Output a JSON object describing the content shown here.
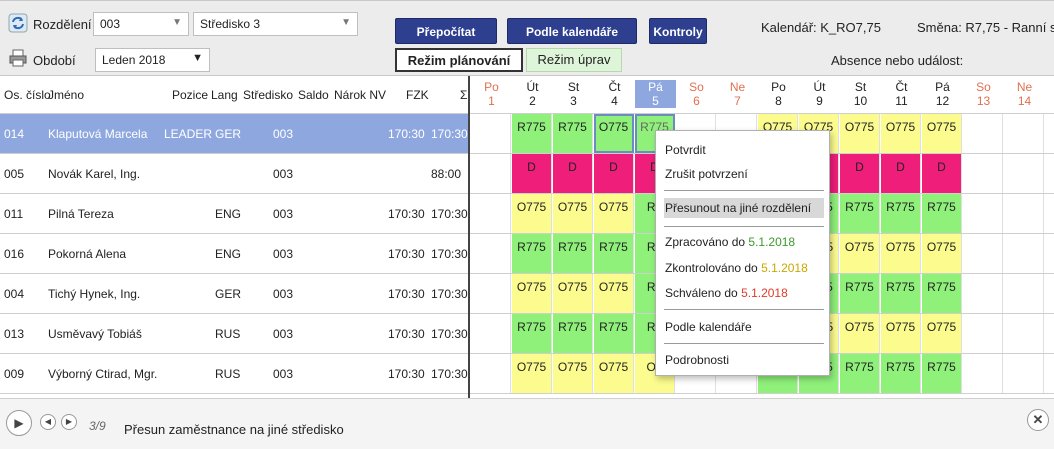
{
  "toolbar": {
    "rozdeleni_label": "Rozdělení",
    "obdobi_label": "Období",
    "rozdeleni_value": "003",
    "stredisko_value": "Středisko 3",
    "obdobi_value": "Leden 2018",
    "btn_prepocitat": "Přepočítat",
    "btn_podle_kalendare": "Podle kalendáře",
    "btn_kontroly": "Kontroly",
    "mode_planovani": "Režim plánování",
    "mode_uprav": "Režim úprav",
    "kalendar": "Kalendář: K_RO7,75",
    "smena": "Směna: R7,75 - Ranní s",
    "absence": "Absence nebo událost:"
  },
  "columns": {
    "os_cislo": "Os. číslo",
    "jmeno": "Jméno",
    "pozice": "Pozice",
    "lang": "Lang",
    "stredisko": "Středisko",
    "saldo": "Saldo",
    "narok_nv": "Nárok NV",
    "fzk": "FZK",
    "sigma": "Σ"
  },
  "days": [
    {
      "name": "Po",
      "num": "1",
      "weekend": true
    },
    {
      "name": "Út",
      "num": "2",
      "weekend": false
    },
    {
      "name": "St",
      "num": "3",
      "weekend": false
    },
    {
      "name": "Čt",
      "num": "4",
      "weekend": false
    },
    {
      "name": "Pá",
      "num": "5",
      "weekend": false,
      "selected": true
    },
    {
      "name": "So",
      "num": "6",
      "weekend": true
    },
    {
      "name": "Ne",
      "num": "7",
      "weekend": true
    },
    {
      "name": "Po",
      "num": "8",
      "weekend": false
    },
    {
      "name": "Út",
      "num": "9",
      "weekend": false
    },
    {
      "name": "St",
      "num": "10",
      "weekend": false
    },
    {
      "name": "Čt",
      "num": "11",
      "weekend": false
    },
    {
      "name": "Pá",
      "num": "12",
      "weekend": false
    },
    {
      "name": "So",
      "num": "13",
      "weekend": true
    },
    {
      "name": "Ne",
      "num": "14",
      "weekend": true
    }
  ],
  "employees": [
    {
      "os": "014",
      "jmeno": "Klaputová Marcela",
      "pozice": "LEADER",
      "lang": "GER",
      "stredisko": "003",
      "fzk": "170:30",
      "sigma": "170:30",
      "selected": true,
      "shifts": [
        "",
        "R775",
        "R775",
        "O775",
        "R775",
        "",
        "",
        "O775",
        "O775",
        "O775",
        "O775",
        "O775",
        "",
        ""
      ],
      "colors": [
        "e",
        "g",
        "g",
        "g",
        "g",
        "e",
        "e",
        "y",
        "y",
        "y",
        "y",
        "y",
        "e",
        "e"
      ]
    },
    {
      "os": "005",
      "jmeno": "Novák Karel, Ing.",
      "pozice": "",
      "lang": "",
      "stredisko": "003",
      "fzk": "",
      "sigma": "88:00",
      "shifts": [
        "",
        "D",
        "D",
        "D",
        "D",
        "",
        "",
        "D",
        "D",
        "D",
        "D",
        "D",
        "",
        ""
      ],
      "colors": [
        "e",
        "p",
        "p",
        "p",
        "p",
        "e",
        "e",
        "p",
        "p",
        "p",
        "p",
        "p",
        "e",
        "e"
      ]
    },
    {
      "os": "011",
      "jmeno": "Pilná Tereza",
      "pozice": "",
      "lang": "ENG",
      "stredisko": "003",
      "fzk": "170:30",
      "sigma": "170:30",
      "shifts": [
        "",
        "O775",
        "O775",
        "O775",
        "R7",
        "",
        "",
        "R775",
        "R775",
        "R775",
        "R775",
        "R775",
        "",
        ""
      ],
      "colors": [
        "e",
        "y",
        "y",
        "y",
        "g",
        "e",
        "e",
        "g",
        "g",
        "g",
        "g",
        "g",
        "e",
        "e"
      ]
    },
    {
      "os": "016",
      "jmeno": "Pokorná Alena",
      "pozice": "",
      "lang": "ENG",
      "stredisko": "003",
      "fzk": "170:30",
      "sigma": "170:30",
      "shifts": [
        "",
        "R775",
        "R775",
        "R775",
        "R7",
        "",
        "",
        "O775",
        "O775",
        "O775",
        "O775",
        "O775",
        "",
        ""
      ],
      "colors": [
        "e",
        "g",
        "g",
        "g",
        "g",
        "e",
        "e",
        "y",
        "y",
        "y",
        "y",
        "y",
        "e",
        "e"
      ]
    },
    {
      "os": "004",
      "jmeno": "Tichý Hynek, Ing.",
      "pozice": "",
      "lang": "GER",
      "stredisko": "003",
      "fzk": "170:30",
      "sigma": "170:30",
      "shifts": [
        "",
        "O775",
        "O775",
        "O775",
        "R7",
        "",
        "",
        "R775",
        "R775",
        "R775",
        "R775",
        "R775",
        "",
        ""
      ],
      "colors": [
        "e",
        "y",
        "y",
        "y",
        "g",
        "e",
        "e",
        "g",
        "g",
        "g",
        "g",
        "g",
        "e",
        "e"
      ]
    },
    {
      "os": "013",
      "jmeno": "Usměvavý Tobiáš",
      "pozice": "",
      "lang": "RUS",
      "stredisko": "003",
      "fzk": "170:30",
      "sigma": "170:30",
      "shifts": [
        "",
        "R775",
        "R775",
        "R775",
        "R7",
        "",
        "",
        "O775",
        "O775",
        "O775",
        "O775",
        "O775",
        "",
        ""
      ],
      "colors": [
        "e",
        "g",
        "g",
        "g",
        "g",
        "e",
        "e",
        "y",
        "y",
        "y",
        "y",
        "y",
        "e",
        "e"
      ]
    },
    {
      "os": "009",
      "jmeno": "Výborný Ctirad, Mgr.",
      "pozice": "",
      "lang": "RUS",
      "stredisko": "003",
      "fzk": "170:30",
      "sigma": "170:30",
      "shifts": [
        "",
        "O775",
        "O775",
        "O775",
        "O7",
        "",
        "",
        "R775",
        "R775",
        "R775",
        "R775",
        "R775",
        "",
        ""
      ],
      "colors": [
        "e",
        "y",
        "y",
        "y",
        "y",
        "e",
        "e",
        "g",
        "g",
        "g",
        "g",
        "g",
        "e",
        "e"
      ]
    }
  ],
  "context_menu": {
    "potvrdit": "Potvrdit",
    "zrusit": "Zrušit potvrzení",
    "presunout": "Přesunout na jiné rozdělení",
    "zpracovano": "Zpracováno do ",
    "zpracovano_date": "5.1.2018",
    "zkontrolovano": "Zkontrolováno do ",
    "zkontrolovano_date": "5.1.2018",
    "schvaleno": "Schváleno do ",
    "schvaleno_date": "5.1.2018",
    "podle_kalendare": "Podle kalendáře",
    "podrobnosti": "Podrobnosti"
  },
  "bottom": {
    "page": "3/9",
    "message": "Přesun zaměstnance na jiné středisko"
  },
  "colors": {
    "green": "#8ff07a",
    "yellow": "#fbfb8e",
    "pink": "#ee1e7a",
    "selected_row": "#8ea8df",
    "button_blue": "#2e3f8f"
  }
}
